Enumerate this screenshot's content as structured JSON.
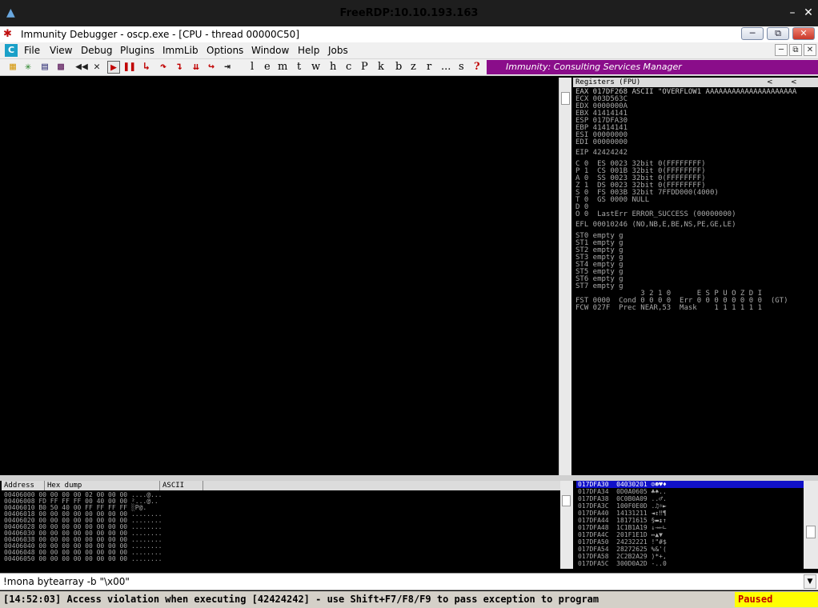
{
  "rdp": {
    "title": "FreeRDP:10.10.193.163",
    "minimize": "–",
    "close": "✕"
  },
  "app": {
    "title": "Immunity Debugger - oscp.exe - [CPU - thread 00000C50]"
  },
  "menu": [
    "File",
    "View",
    "Debug",
    "Plugins",
    "ImmLib",
    "Options",
    "Window",
    "Help",
    "Jobs"
  ],
  "toolbar": {
    "letters": [
      "l",
      "e",
      "m",
      "t",
      "w",
      "h",
      "c",
      "P",
      "k",
      "b",
      "z",
      "r",
      "...",
      "s",
      "?"
    ],
    "banner": "Immunity: Consulting Services Manager"
  },
  "registers": {
    "header": "Registers (FPU)",
    "lines": [
      "EAX 017DF268 ASCII \"OVERFLOW1 AAAAAAAAAAAAAAAAAAAAA",
      "ECX 003D563C",
      "EDX 0000000A",
      "EBX 41414141",
      "ESP 017DFA30",
      "EBP 41414141",
      "ESI 00000000",
      "EDI 00000000",
      "",
      "EIP 42424242",
      "",
      "C 0  ES 0023 32bit 0(FFFFFFFF)",
      "P 1  CS 001B 32bit 0(FFFFFFFF)",
      "A 0  SS 0023 32bit 0(FFFFFFFF)",
      "Z 1  DS 0023 32bit 0(FFFFFFFF)",
      "S 0  FS 003B 32bit 7FFDD000(4000)",
      "T 0  GS 0000 NULL",
      "D 0",
      "O 0  LastErr ERROR_SUCCESS (00000000)",
      "",
      "EFL 00010246 (NO,NB,E,BE,NS,PE,GE,LE)",
      "",
      "ST0 empty g",
      "ST1 empty g",
      "ST2 empty g",
      "ST3 empty g",
      "ST4 empty g",
      "ST5 empty g",
      "ST6 empty g",
      "ST7 empty g",
      "               3 2 1 0      E S P U O Z D I",
      "FST 0000  Cond 0 0 0 0  Err 0 0 0 0 0 0 0 0  (GT)",
      "FCW 027F  Prec NEAR,53  Mask    1 1 1 1 1 1"
    ]
  },
  "dump": {
    "columns": [
      "Address",
      "Hex dump",
      "ASCII"
    ],
    "rows": [
      "00406000 00 00 00 00 02 00 00 00 ....@...",
      "00406008 FD FF FF FF 00 40 00 00 ²...@..",
      "00406010 B0 50 40 00 FF FF FF FF ░P@.    ",
      "00406018 00 00 00 00 00 00 00 00 ........",
      "00406020 00 00 00 00 00 00 00 00 ........",
      "00406028 00 00 00 00 00 00 00 00 ........",
      "00406030 00 00 00 00 00 00 00 00 ........",
      "00406038 00 00 00 00 00 00 00 00 ........",
      "00406040 00 00 00 00 00 00 00 00 ........",
      "00406048 00 00 00 00 00 00 00 00 ........",
      "00406050 00 00 00 00 00 00 00 00 ........"
    ]
  },
  "stack": {
    "rows": [
      "017DFA30  04030201 ☺☻♥♦",
      "017DFA34  0D0A0605 ♣♠..",
      "017DFA38  0C0B0A09 ..♂.",
      "017DFA3C  100F0E0D .♫☼►",
      "017DFA40  14131211 ◄↕‼¶",
      "017DFA44  18171615 §▬↨↑",
      "017DFA48  1C1B1A19 ↓→←∟",
      "017DFA4C  201F1E1D ↔▲▼ ",
      "017DFA50  24232221 !\"#$",
      "017DFA54  28272625 %&'(",
      "017DFA58  2C2B2A29 )*+,",
      "017DFA5C  300D0A2D -..0"
    ]
  },
  "command": {
    "value": "!mona bytearray -b \"\\x00\""
  },
  "status": {
    "message": "[14:52:03] Access violation when executing [42424242] - use Shift+F7/F8/F9 to pass exception to program",
    "state": "Paused"
  }
}
